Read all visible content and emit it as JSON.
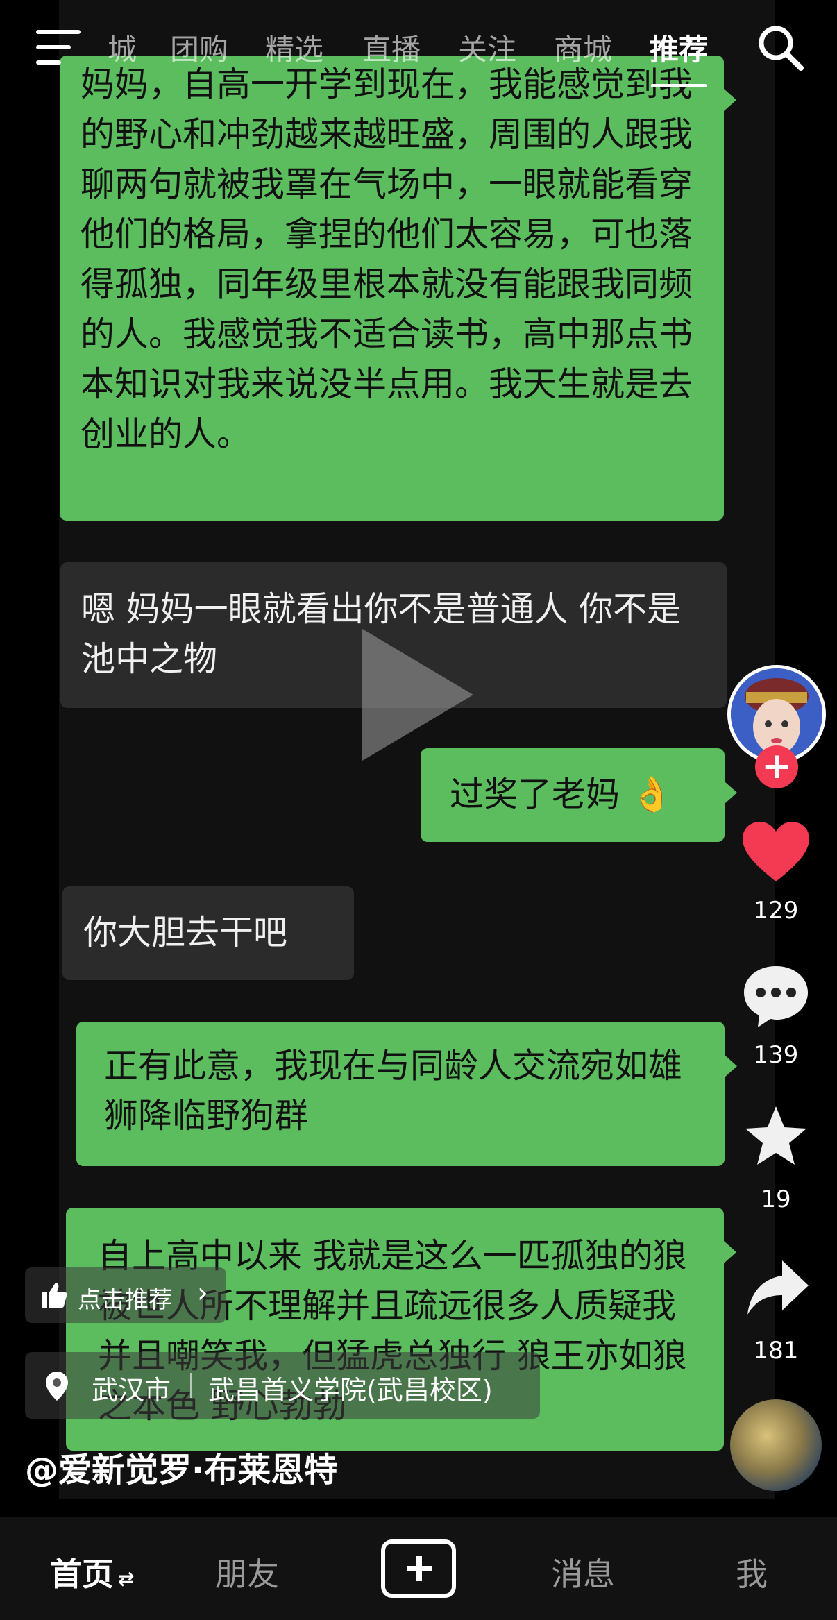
{
  "top_nav": {
    "tabs": [
      {
        "label": "城"
      },
      {
        "label": "团购"
      },
      {
        "label": "精选"
      },
      {
        "label": "直播"
      },
      {
        "label": "关注"
      },
      {
        "label": "商城"
      },
      {
        "label": "推荐"
      }
    ],
    "active_tab": "推荐"
  },
  "chat": {
    "messages": [
      {
        "side": "right",
        "text": "妈妈，自高一开学到现在，我能感觉到我的野心和冲劲越来越旺盛，周围的人跟我聊两句就被我罩在气场中，一眼就能看穿他们的格局，拿捏的他们太容易，可也落得孤独，同年级里根本就没有能跟我同频的人。我感觉我不适合读书，高中那点书本知识对我来说没半点用。我天生就是去创业的人。"
      },
      {
        "side": "left",
        "text": "嗯 妈妈一眼就看出你不是普通人 你不是池中之物"
      },
      {
        "side": "right",
        "text": "过奖了老妈 👌"
      },
      {
        "side": "left",
        "text": "你大胆去干吧"
      },
      {
        "side": "right",
        "text": "正有此意，我现在与同龄人交流宛如雄狮降临野狗群"
      },
      {
        "side": "right",
        "text": "自上高中以来 我就是这么一匹孤独的狼 被世人所不理解并且疏远很多人质疑我 并且嘲笑我，但猛虎总独行 狼王亦如狼之本色 野心勃勃"
      }
    ]
  },
  "actions": {
    "likes": "129",
    "comments": "139",
    "favorites": "19",
    "shares": "181"
  },
  "overlay": {
    "recommend_label": "点击推荐",
    "location_city": "武汉市",
    "location_place": "武昌首义学院(武昌校区)",
    "author": "@爱新觉罗·布莱恩特"
  },
  "bottom_nav": {
    "home": "首页",
    "friends": "朋友",
    "messages": "消息",
    "me": "我"
  },
  "colors": {
    "bubble_green": "#5cbd5f",
    "bubble_gray": "#2b2b2b",
    "like_red": "#f43a53"
  }
}
